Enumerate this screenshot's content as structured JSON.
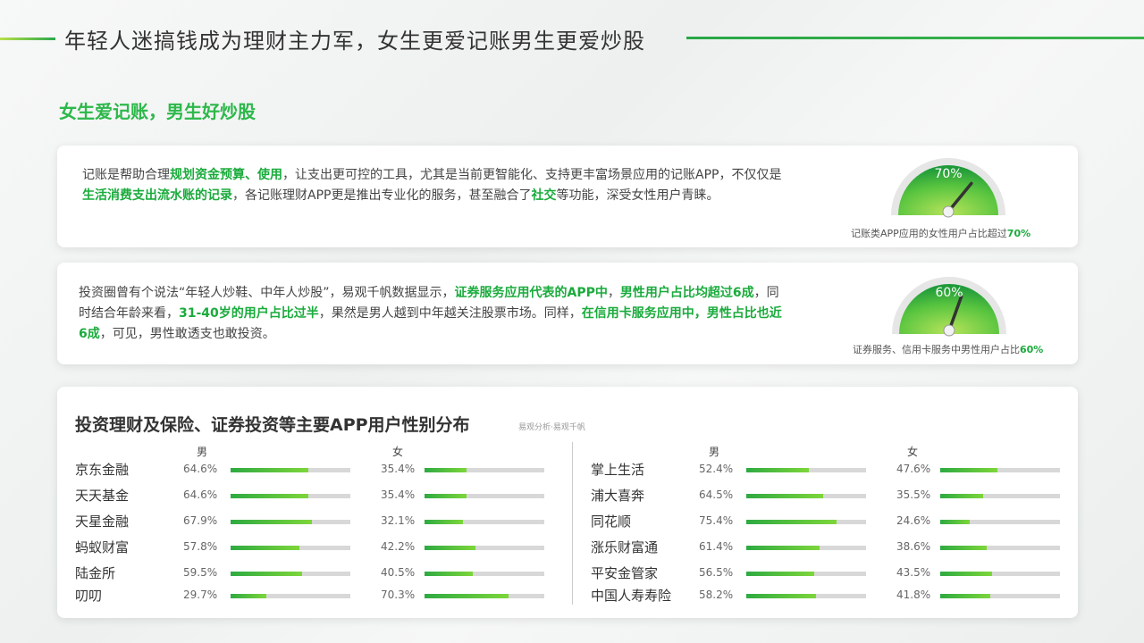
{
  "header": {
    "title": "年轻人迷搞钱成为理财主力军，女生更爱记账男生更爱炒股",
    "accent_color": "#2db84a"
  },
  "section": {
    "title": "女生爱记账，男生好炒股"
  },
  "card1": {
    "segments": [
      {
        "t": "记账是帮助合理",
        "h": false
      },
      {
        "t": "规划资金预算、使用",
        "h": true
      },
      {
        "t": "，让支出更可控的工具，尤其是当前更智能化、支持更丰富场景应用的记账APP，不仅仅是",
        "h": false
      },
      {
        "t": "生活消费支出流水账的记录",
        "h": true
      },
      {
        "t": "，各记账理财APP更是推出专业化的服务，甚至融合了",
        "h": false
      },
      {
        "t": "社交",
        "h": true
      },
      {
        "t": "等功能，深受女性用户青睐。",
        "h": false
      }
    ],
    "gauge": {
      "value": 70,
      "label": "70%"
    },
    "caption": "记账类APP应用的女性用户占比超过",
    "caption_pct": "70%"
  },
  "card2": {
    "segments": [
      {
        "t": "投资圈曾有个说法“年轻人炒鞋、中年人炒股”，易观千帆数据显示，",
        "h": false
      },
      {
        "t": "证券服务应用代表的APP中",
        "h": true
      },
      {
        "t": "，",
        "h": false
      },
      {
        "t": "男性用户占比均超过6成",
        "h": true
      },
      {
        "t": "，同时结合年龄来看，",
        "h": false
      },
      {
        "t": "31-40岁的用户占比过半",
        "h": true
      },
      {
        "t": "，果然是男人越到中年越关注股票市场。同样，",
        "h": false
      },
      {
        "t": "在信用卡服务应用中，男性占比也近6成",
        "h": true
      },
      {
        "t": "，可见，男性敢透支也敢投资。",
        "h": false
      }
    ],
    "gauge": {
      "value": 60,
      "label": "60%"
    },
    "caption": "证券服务、信用卡服务中男性用户占比",
    "caption_pct": "60%"
  },
  "distribution": {
    "title": "投资理财及保险、证券投资等主要APP用户性别分布",
    "source": "易观分析·易观千帆",
    "male_label": "男",
    "female_label": "女",
    "left": [
      {
        "name": "京东金融",
        "male": 64.6,
        "female": 35.4,
        "male_text": "64.6%",
        "female_text": "35.4%"
      },
      {
        "name": "天天基金",
        "male": 64.6,
        "female": 35.4,
        "male_text": "64.6%",
        "female_text": "35.4%"
      },
      {
        "name": "天星金融",
        "male": 67.9,
        "female": 32.1,
        "male_text": "67.9%",
        "female_text": "32.1%"
      },
      {
        "name": "蚂蚁财富",
        "male": 57.8,
        "female": 42.2,
        "male_text": "57.8%",
        "female_text": "42.2%"
      },
      {
        "name": "陆金所",
        "male": 59.5,
        "female": 40.5,
        "male_text": "59.5%",
        "female_text": "40.5%"
      },
      {
        "name": "叨叨",
        "male": 29.7,
        "female": 70.3,
        "male_text": "29.7%",
        "female_text": "70.3%"
      }
    ],
    "right": [
      {
        "name": "掌上生活",
        "male": 52.4,
        "female": 47.6,
        "male_text": "52.4%",
        "female_text": "47.6%"
      },
      {
        "name": "浦大喜奔",
        "male": 64.5,
        "female": 35.5,
        "male_text": "64.5%",
        "female_text": "35.5%"
      },
      {
        "name": "同花顺",
        "male": 75.4,
        "female": 24.6,
        "male_text": "75.4%",
        "female_text": "24.6%"
      },
      {
        "name": "涨乐财富通",
        "male": 61.4,
        "female": 38.6,
        "male_text": "61.4%",
        "female_text": "38.6%"
      },
      {
        "name": "平安金管家",
        "male": 56.5,
        "female": 43.5,
        "male_text": "56.5%",
        "female_text": "43.5%"
      },
      {
        "name": "中国人寿寿险",
        "male": 58.2,
        "female": 41.8,
        "male_text": "58.2%",
        "female_text": "41.8%"
      }
    ]
  }
}
